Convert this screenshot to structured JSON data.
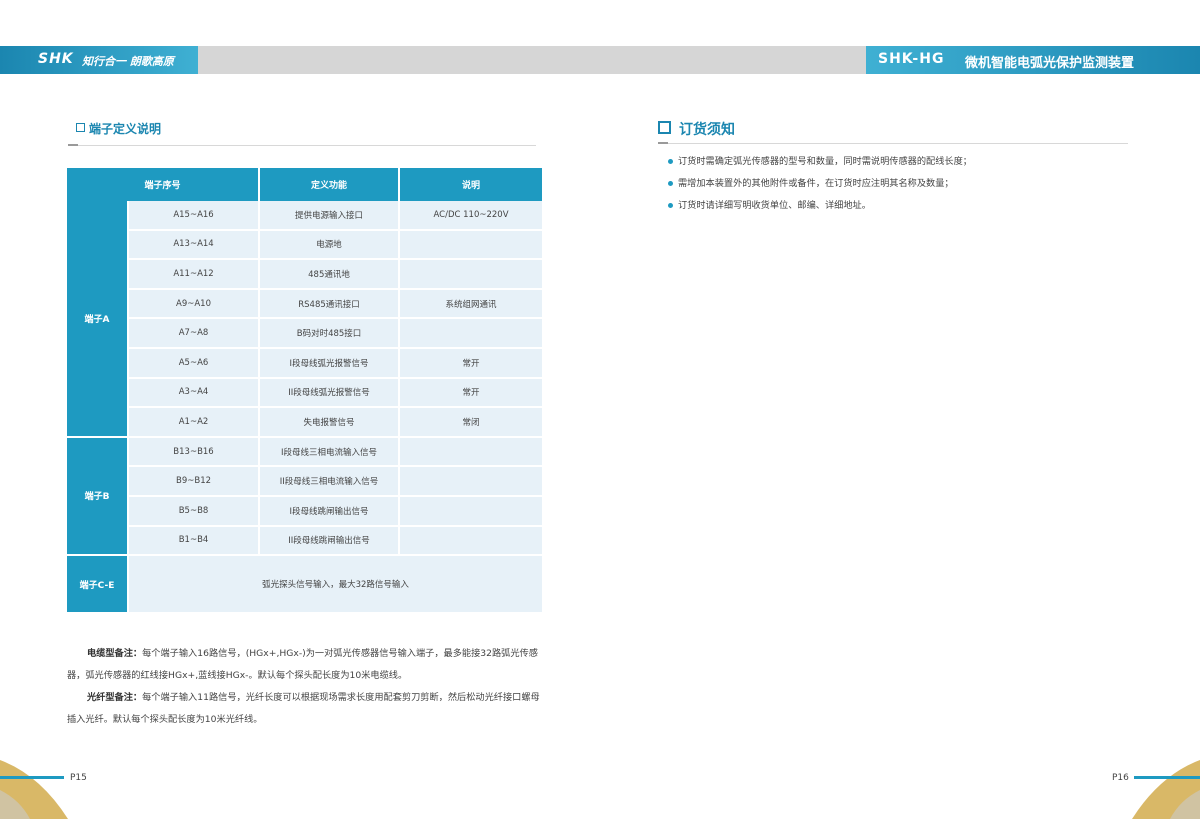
{
  "header": {
    "logo": "SHK",
    "slogan": "知行合一 朗歌高原",
    "model": "SHK-HG",
    "product_title": "微机智能电弧光保护监测装置"
  },
  "left": {
    "section_title": "端子定义说明",
    "table": {
      "headers": [
        "端子序号",
        "定义功能",
        "说明"
      ],
      "groups": [
        {
          "name": "端子A",
          "rows": [
            {
              "seq": "A15~A16",
              "func": "提供电源输入接口",
              "note": "AC/DC 110~220V"
            },
            {
              "seq": "A13~A14",
              "func": "电源地",
              "note": ""
            },
            {
              "seq": "A11~A12",
              "func": "485通讯地",
              "note": ""
            },
            {
              "seq": "A9~A10",
              "func": "RS485通讯接口",
              "note": "系统组网通讯"
            },
            {
              "seq": "A7~A8",
              "func": "B码对时485接口",
              "note": ""
            },
            {
              "seq": "A5~A6",
              "func": "I段母线弧光报警信号",
              "note": "常开"
            },
            {
              "seq": "A3~A4",
              "func": "II段母线弧光报警信号",
              "note": "常开"
            },
            {
              "seq": "A1~A2",
              "func": "失电报警信号",
              "note": "常闭"
            }
          ]
        },
        {
          "name": "端子B",
          "rows": [
            {
              "seq": "B13~B16",
              "func": "I段母线三相电流输入信号",
              "note": ""
            },
            {
              "seq": "B9~B12",
              "func": "II段母线三相电流输入信号",
              "note": ""
            },
            {
              "seq": "B5~B8",
              "func": "I段母线跳闸输出信号",
              "note": ""
            },
            {
              "seq": "B1~B4",
              "func": "II段母线跳闸输出信号",
              "note": ""
            }
          ]
        },
        {
          "name": "端子C-E",
          "desc": "弧光探头信号输入，最大32路信号输入"
        }
      ]
    },
    "notes": [
      {
        "label": "电缆型备注：",
        "text": "每个端子输入16路信号，(HGx+,HGx-)为一对弧光传感器信号输入端子，最多能接32路弧光传感器，弧光传感器的红线接HGx+,蓝线接HGx-。默认每个探头配长度为10米电缆线。"
      },
      {
        "label": "光纤型备注：",
        "text": "每个端子输入11路信号，光纤长度可以根据现场需求长度用配套剪刀剪断，然后松动光纤接口螺母插入光纤。默认每个探头配长度为10米光纤线。"
      }
    ],
    "page_number": "P15"
  },
  "right": {
    "section_title": "订货须知",
    "items": [
      "订货时需确定弧光传感器的型号和数量，同时需说明传感器的配线长度；",
      "需增加本装置外的其他附件或备件，在订货时应注明其名称及数量；",
      "订货时请详细写明收货单位、邮编、详细地址。"
    ],
    "page_number": "P16"
  },
  "colors": {
    "accent": "#1e9ac1",
    "table_cell": "#e7f1f8",
    "gold": "#d9b867"
  }
}
